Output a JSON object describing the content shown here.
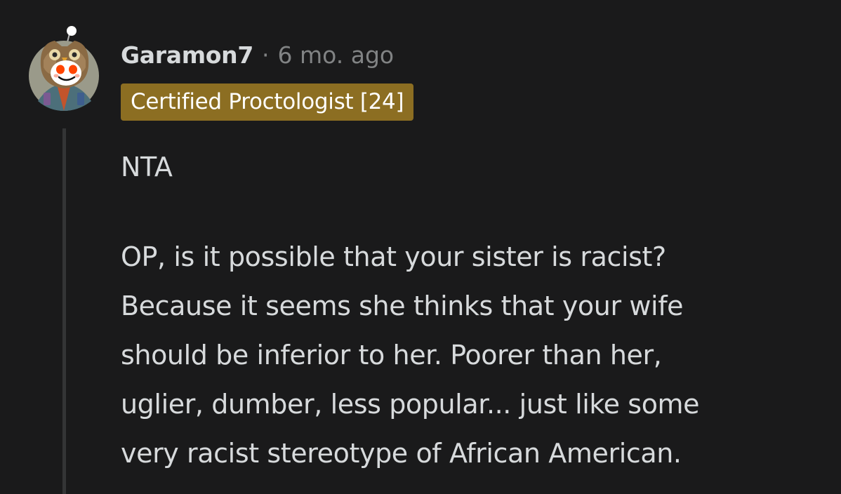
{
  "comment": {
    "username": "Garamon7",
    "separator": "·",
    "timestamp": "6 mo. ago",
    "flair": "Certified Proctologist [24]",
    "body": {
      "paragraph_1": "NTA",
      "paragraph_2_lines": [
        "OP, is it possible that your sister is racist?",
        "Because it seems she thinks that your wife",
        "should be inferior to her. Poorer than her,",
        "uglier, dumber, less popular... just like some",
        "very racist stereotype of African American."
      ]
    },
    "colors": {
      "background": "#1a1a1b",
      "text": "#d7dadc",
      "muted": "#818384",
      "flair_background": "#8c6e22",
      "thread_line": "#343536"
    },
    "icons": {
      "avatar": "owl-avatar-icon"
    }
  }
}
